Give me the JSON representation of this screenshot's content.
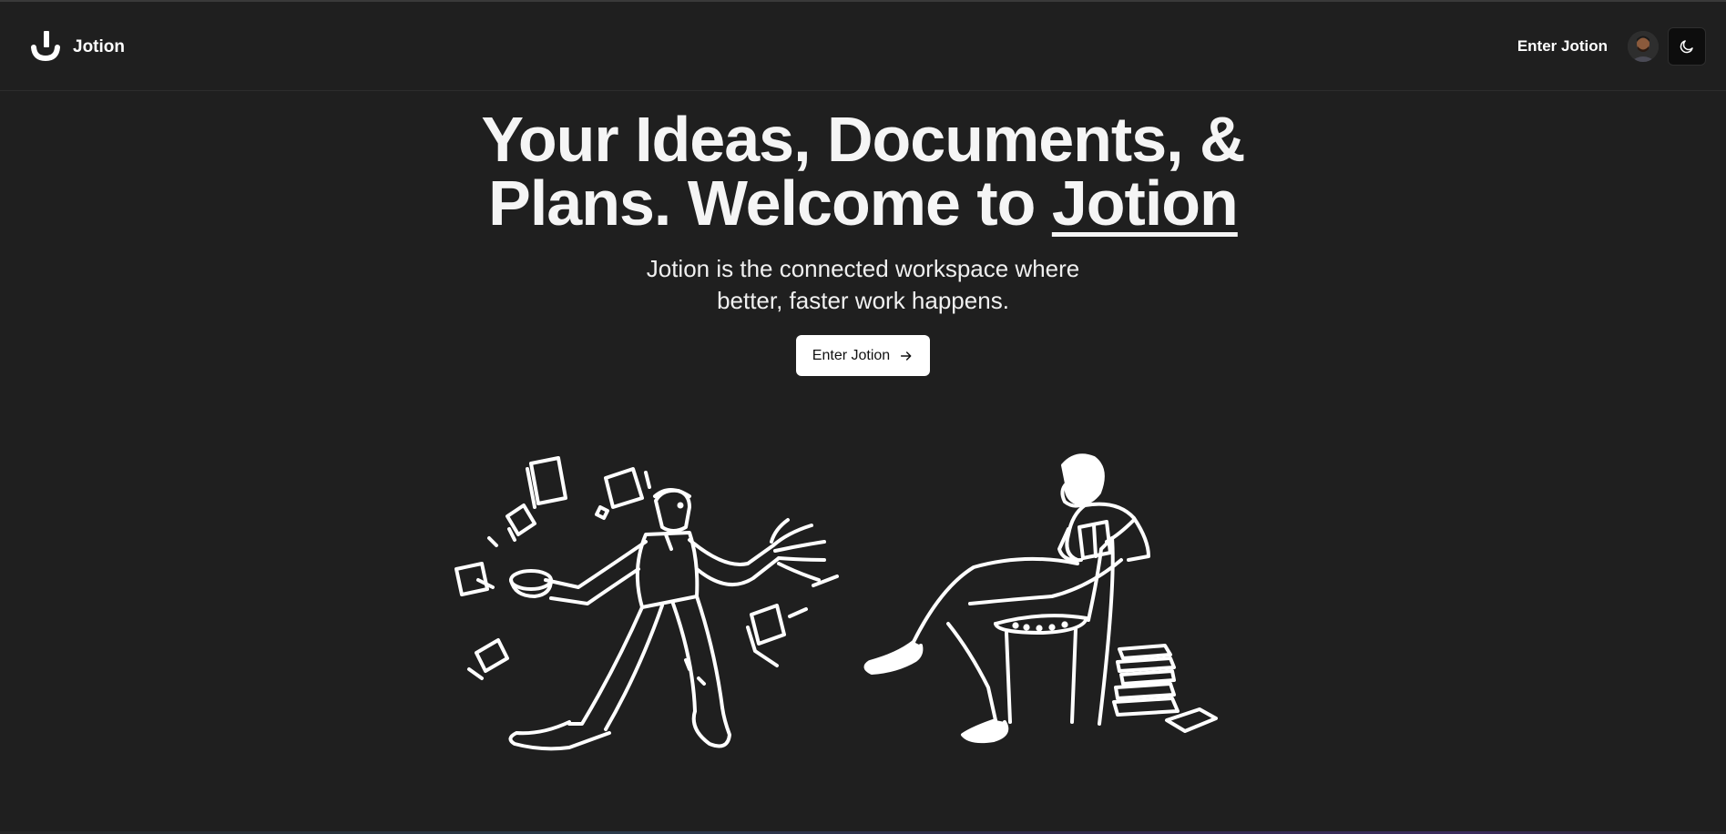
{
  "header": {
    "logo_text": "Jotion",
    "nav_link": "Enter Jotion",
    "avatar_icon": "user-avatar",
    "theme_icon": "moon-icon"
  },
  "hero": {
    "title_line1": "Your Ideas, Documents, &",
    "title_line2_prefix": "Plans. Welcome to ",
    "title_line2_brand": "Jotion",
    "subtitle_line1": "Jotion is the connected workspace where",
    "subtitle_line2": "better, faster work happens.",
    "cta_label": "Enter Jotion",
    "cta_icon": "arrow-right-icon"
  },
  "illustrations": [
    {
      "icon": "man-throwing-papers-illustration"
    },
    {
      "icon": "woman-reading-in-chair-illustration"
    }
  ],
  "colors": {
    "background": "#1f1f1f",
    "text": "#f2f2f2",
    "cta_bg": "#ffffff",
    "cta_text": "#111111"
  }
}
